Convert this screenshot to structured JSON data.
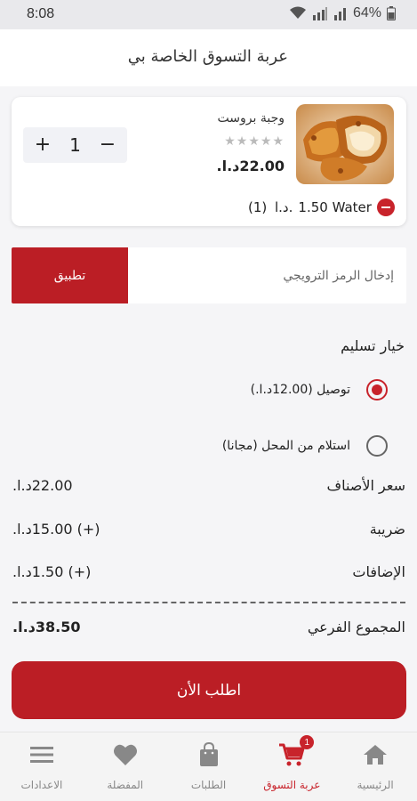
{
  "status_bar": {
    "time": "8:08",
    "battery": "64%"
  },
  "header": {
    "title": "عربة التسوق الخاصة بي"
  },
  "cart": {
    "item": {
      "name": "وجبة بروست",
      "rating_stars": "★★★★★",
      "rating": 0,
      "price": "22.00د.ا.",
      "quantity": "1",
      "addon": {
        "text": "1.50 Water",
        "currency": "د.ا.",
        "count": "(1)"
      }
    }
  },
  "promo": {
    "placeholder": "إدخال الرمز الترويجي",
    "apply_label": "تطبيق"
  },
  "delivery": {
    "title": "خيار تسليم",
    "options": [
      {
        "label": "توصيل (12.00د.ا.)",
        "selected": true
      },
      {
        "label": "استلام من المحل (مجانا)",
        "selected": false
      }
    ]
  },
  "summary": {
    "items_price": {
      "label": "سعر الأصناف",
      "value": "22.00د.ا."
    },
    "tax": {
      "label": "ضريبة",
      "value": "(+) 15.00د.ا."
    },
    "addons": {
      "label": "الإضافات",
      "value": "(+) 1.50د.ا."
    },
    "subtotal": {
      "label": "المجموع الفرعي",
      "value": "38.50د.ا."
    }
  },
  "order_button": {
    "label": "اطلب الأن"
  },
  "bottom_nav": {
    "items": [
      {
        "label": "الرئيسية",
        "icon": "home-icon",
        "active": false
      },
      {
        "label": "عربة التسوق",
        "icon": "cart-icon",
        "active": true,
        "badge": "1"
      },
      {
        "label": "الطلبات",
        "icon": "bag-icon",
        "active": false
      },
      {
        "label": "المفضلة",
        "icon": "heart-icon",
        "active": false
      },
      {
        "label": "الاعدادات",
        "icon": "menu-icon",
        "active": false
      }
    ]
  },
  "colors": {
    "accent": "#c8232b",
    "button": "#bb1e25"
  }
}
